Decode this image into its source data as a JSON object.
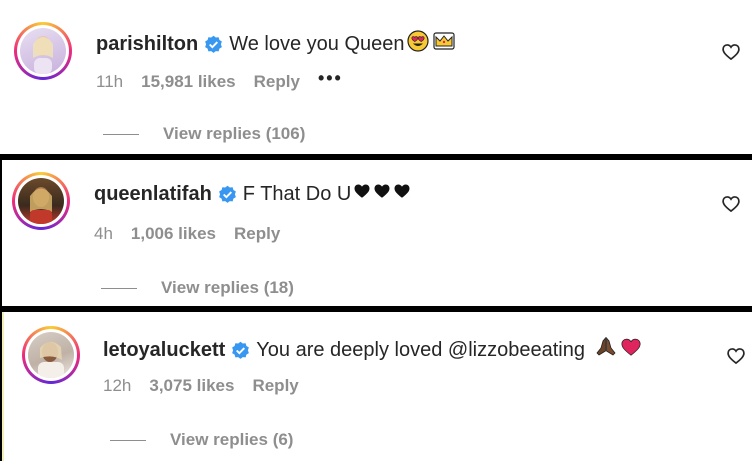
{
  "comments": [
    {
      "username": "parishilton",
      "text": "We love you Queen",
      "time": "11h",
      "likes": "15,981 likes",
      "reply_label": "Reply",
      "more_label": "•••",
      "view_replies": "View replies (106)",
      "emojis": [
        "heart-eyes-emoji",
        "crown-emoji"
      ]
    },
    {
      "username": "queenlatifah",
      "text": "F That Do U",
      "time": "4h",
      "likes": "1,006 likes",
      "reply_label": "Reply",
      "view_replies": "View replies (18)",
      "emojis": [
        "black-heart-emoji",
        "black-heart-emoji",
        "black-heart-emoji"
      ]
    },
    {
      "username": "letoyaluckett",
      "text": "You are deeply loved @lizzobeeating",
      "time": "12h",
      "likes": "3,075 likes",
      "reply_label": "Reply",
      "view_replies": "View replies (6)",
      "emojis": [
        "praying-hands-emoji",
        "red-heart-emoji"
      ]
    }
  ],
  "colors": {
    "verified": "#3897f0",
    "muted": "#8e8e8e",
    "text": "#262626",
    "separator": "#000000"
  }
}
